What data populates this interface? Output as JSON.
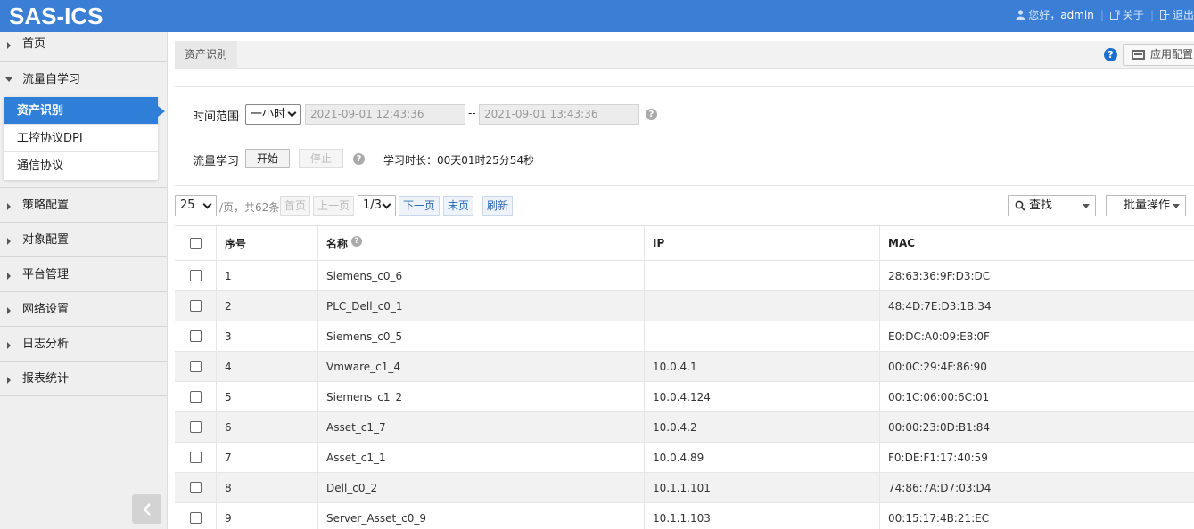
{
  "header": {
    "logo": "SAS-ICS",
    "greeting": "您好，",
    "username": "admin",
    "about": "关于",
    "logout": "退出"
  },
  "sidebar": {
    "items": [
      {
        "label": "首页"
      },
      {
        "label": "流量自学习"
      },
      {
        "label": "策略配置"
      },
      {
        "label": "对象配置"
      },
      {
        "label": "平台管理"
      },
      {
        "label": "网络设置"
      },
      {
        "label": "日志分析"
      },
      {
        "label": "报表统计"
      }
    ],
    "subitems": [
      {
        "label": "资产识别"
      },
      {
        "label": "工控协议DPI"
      },
      {
        "label": "通信协议"
      }
    ]
  },
  "tabs": {
    "active": "资产识别",
    "help": "?",
    "app_config": "应用配置"
  },
  "filter": {
    "time_range_label": "时间范围",
    "time_range_value": "一小时",
    "start_time": "2021-09-01 12:43:36",
    "dash": "--",
    "end_time": "2021-09-01 13:43:36",
    "learn_label": "流量学习",
    "start_btn": "开始",
    "stop_btn": "停止",
    "duration": "学习时长：00天01时25分54秒"
  },
  "pager": {
    "page_size": "25",
    "per_page_text": "/页，共62条",
    "first": "首页",
    "prev": "上一页",
    "page": "1/3",
    "next": "下一页",
    "last": "末页",
    "refresh": "刷新",
    "search": "查找",
    "batch": "批量操作"
  },
  "table": {
    "columns": [
      "序号",
      "名称",
      "IP",
      "MAC"
    ],
    "rows": [
      [
        "1",
        "Siemens_c0_6",
        "",
        "28:63:36:9F:D3:DC"
      ],
      [
        "2",
        "PLC_Dell_c0_1",
        "",
        "48:4D:7E:D3:1B:34"
      ],
      [
        "3",
        "Siemens_c0_5",
        "",
        "E0:DC:A0:09:E8:0F"
      ],
      [
        "4",
        "Vmware_c1_4",
        "10.0.4.1",
        "00:0C:29:4F:86:90"
      ],
      [
        "5",
        "Siemens_c1_2",
        "10.0.4.124",
        "00:1C:06:00:6C:01"
      ],
      [
        "6",
        "Asset_c1_7",
        "10.0.4.2",
        "00:00:23:0D:B1:84"
      ],
      [
        "7",
        "Asset_c1_1",
        "10.0.4.89",
        "F0:DE:F1:17:40:59"
      ],
      [
        "8",
        "Dell_c0_2",
        "10.1.1.101",
        "74:86:7A:D7:03:D4"
      ],
      [
        "9",
        "Server_Asset_c0_9",
        "10.1.1.103",
        "00:15:17:4B:21:EC"
      ]
    ]
  }
}
